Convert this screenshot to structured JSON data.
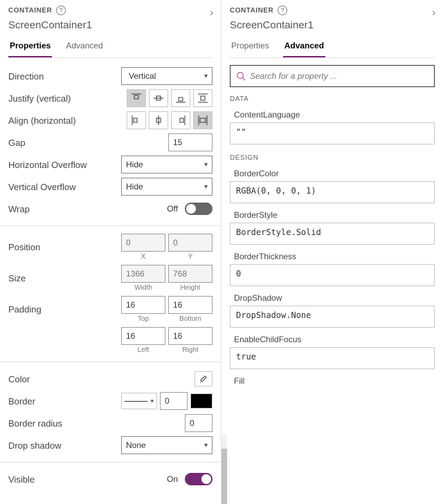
{
  "left": {
    "typeLabel": "CONTAINER",
    "controlName": "ScreenContainer1",
    "tabs": {
      "properties": "Properties",
      "advanced": "Advanced"
    },
    "activeTab": "properties",
    "props": {
      "direction": {
        "label": "Direction",
        "value": "Vertical"
      },
      "justify": {
        "label": "Justify (vertical)",
        "selected": 0
      },
      "align": {
        "label": "Align (horizontal)",
        "selected": 3
      },
      "gap": {
        "label": "Gap",
        "value": "15"
      },
      "hOverflow": {
        "label": "Horizontal Overflow",
        "value": "Hide"
      },
      "vOverflow": {
        "label": "Vertical Overflow",
        "value": "Hide"
      },
      "wrap": {
        "label": "Wrap",
        "state": "Off"
      },
      "position": {
        "label": "Position",
        "x": "0",
        "y": "0",
        "xLabel": "X",
        "yLabel": "Y"
      },
      "size": {
        "label": "Size",
        "w": "1366",
        "h": "768",
        "wLabel": "Width",
        "hLabel": "Height"
      },
      "padding": {
        "label": "Padding",
        "top": "16",
        "bottom": "16",
        "left": "16",
        "right": "16",
        "topLabel": "Top",
        "bottomLabel": "Bottom",
        "leftLabel": "Left",
        "rightLabel": "Right"
      },
      "color": {
        "label": "Color"
      },
      "border": {
        "label": "Border",
        "thickness": "0"
      },
      "borderRadius": {
        "label": "Border radius",
        "value": "0"
      },
      "dropShadow": {
        "label": "Drop shadow",
        "value": "None"
      },
      "visible": {
        "label": "Visible",
        "state": "On"
      }
    }
  },
  "right": {
    "typeLabel": "CONTAINER",
    "controlName": "ScreenContainer1",
    "tabs": {
      "properties": "Properties",
      "advanced": "Advanced"
    },
    "activeTab": "advanced",
    "search": {
      "placeholder": "Search for a property ..."
    },
    "sections": {
      "data": "DATA",
      "design": "DESIGN"
    },
    "props": {
      "contentLanguage": {
        "name": "ContentLanguage",
        "value": "\"\""
      },
      "borderColor": {
        "name": "BorderColor",
        "value": "RGBA(0, 0, 0, 1)"
      },
      "borderStyle": {
        "name": "BorderStyle",
        "value": "BorderStyle.Solid"
      },
      "borderThickness": {
        "name": "BorderThickness",
        "value": "0"
      },
      "dropShadow": {
        "name": "DropShadow",
        "value": "DropShadow.None"
      },
      "enableChildFocus": {
        "name": "EnableChildFocus",
        "value": "true"
      },
      "fill": {
        "name": "Fill"
      }
    }
  }
}
